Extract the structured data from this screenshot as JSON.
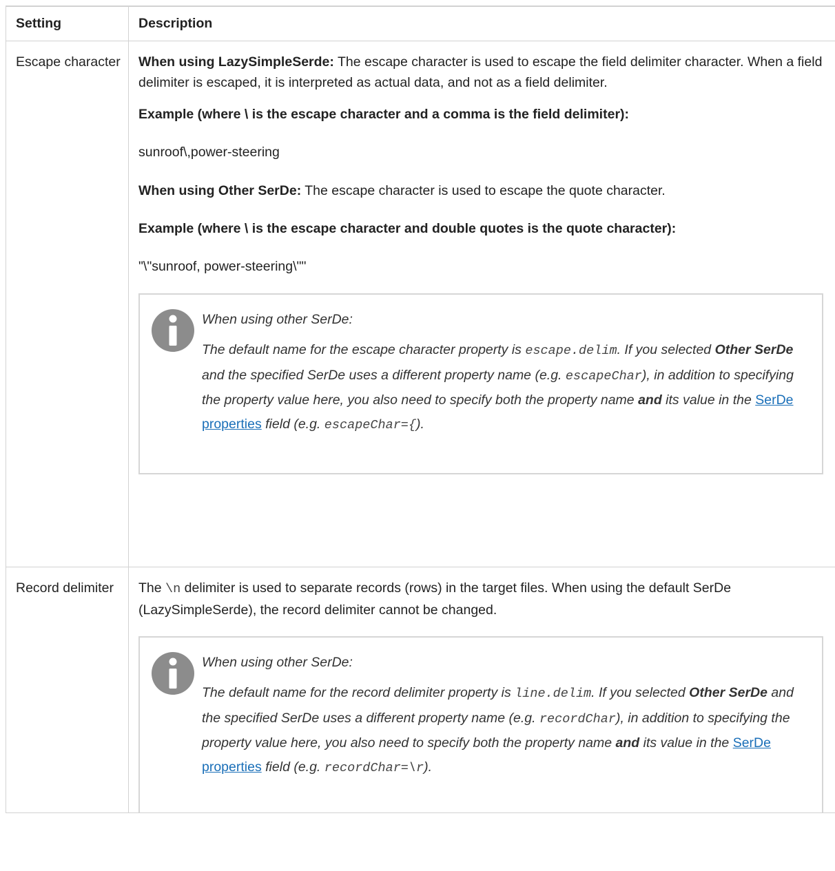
{
  "table": {
    "headers": {
      "setting": "Setting",
      "description": "Description"
    },
    "rows": [
      {
        "setting": "Escape character",
        "p1_lead": "When using LazySimpleSerde:",
        "p1_text": " The escape character is used to escape the field delimiter character. When a field delimiter is escaped, it is interpreted as actual data, and not as a field delimiter.",
        "p2": "Example (where \\ is the escape character and a comma is the field delimiter):",
        "p3": "sunroof\\,power-steering",
        "p4_lead": "When using Other SerDe:",
        "p4_text": " The escape character is used to escape the quote character.",
        "p5": "Example (where \\ is the escape character and double quotes is the quote character):",
        "p6": "\"\\\"sunroof, power-steering\\\"\"",
        "note": {
          "head": "When using other SerDe:",
          "t1": "The default name for the escape character property is ",
          "c1": "escape.delim",
          "t2": ". If you selected ",
          "b1": "Other SerDe",
          "t3": " and the specified SerDe uses a different property name (e.g. ",
          "c2": "escapeChar",
          "t4": "), in addition to specifying the property value here, you also need to specify both the property name ",
          "b2": "and",
          "t5": " its value in the ",
          "link": "SerDe properties",
          "t6": " field (e.g. ",
          "c3": "escapeChar={",
          "t7": ")."
        }
      },
      {
        "setting": "Record delimiter",
        "p1_a": "The ",
        "p1_code": "\\n",
        "p1_b": " delimiter is used to separate records (rows) in the target files. When using the default SerDe (LazySimpleSerde), the record delimiter cannot be changed.",
        "note": {
          "head": "When using other SerDe:",
          "t1": "The default name for the record delimiter property is ",
          "c1": "line.delim",
          "t2": ". If you selected ",
          "b1": "Other SerDe",
          "t3": " and the specified SerDe uses a different property name (e.g. ",
          "c2": "recordChar",
          "t4": "), in addition to specifying the property value here, you also need to specify both the property name ",
          "b2": "and",
          "t5": " its value in the ",
          "link": "SerDe properties",
          "t6": " field (e.g. ",
          "c3": "recordChar=\\r",
          "t7": ")."
        }
      }
    ]
  },
  "icons": {
    "note_icon": "info-icon",
    "color": "#8c8c8c"
  },
  "link_color": "#1a6fb8"
}
